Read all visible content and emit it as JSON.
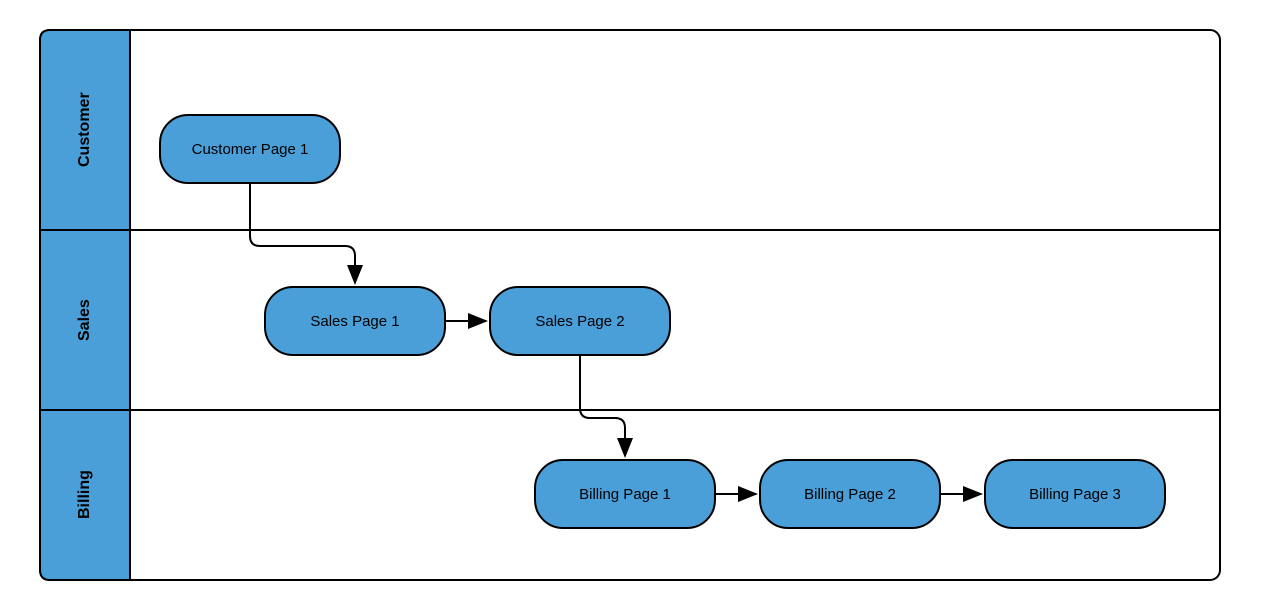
{
  "swimlanes": [
    {
      "name": "Customer"
    },
    {
      "name": "Sales"
    },
    {
      "name": "Billing"
    }
  ],
  "nodes": {
    "customer_page1": "Customer Page 1",
    "sales_page1": "Sales Page 1",
    "sales_page2": "Sales Page 2",
    "billing_page1": "Billing Page 1",
    "billing_page2": "Billing Page 2",
    "billing_page3": "Billing Page 3"
  },
  "colors": {
    "fill": "#4A9FD8",
    "stroke": "#000000"
  }
}
